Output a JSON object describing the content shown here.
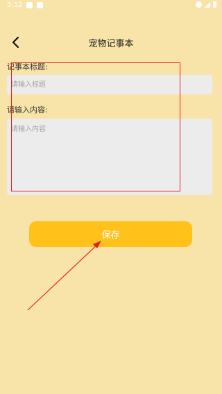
{
  "status_bar": {
    "time": "5:12"
  },
  "header": {
    "title": "宠物记事本"
  },
  "form": {
    "title_label": "记事本标题:",
    "title_placeholder": "请输入标题",
    "content_label": "请输入内容:",
    "content_placeholder": "请输入内容"
  },
  "actions": {
    "save_label": "保存"
  },
  "colors": {
    "background": "#F8E4A8",
    "accent": "#FFC11A",
    "input_bg": "#ECECEC",
    "annotation": "#E02020"
  },
  "icons": {
    "back": "chevron-left-icon"
  }
}
